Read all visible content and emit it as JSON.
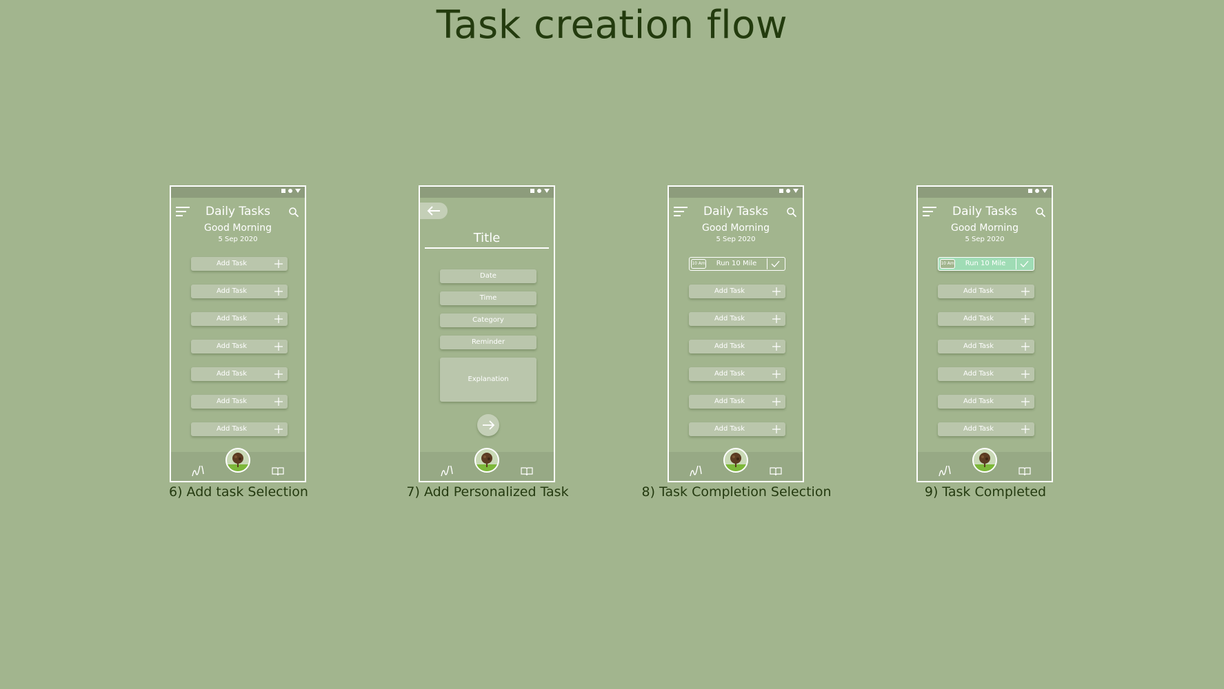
{
  "page_title": "Task creation flow",
  "colors": {
    "background": "#a2b58e",
    "title_text": "#233b0e",
    "button_fill": "#bac6ac",
    "completed_fill": "#9fdcb5",
    "phone_border": "#ffffff"
  },
  "screens": [
    {
      "caption": "6) Add task Selection",
      "app_title": "Daily Tasks",
      "greeting": "Good Morning",
      "date": "5 Sep 2020",
      "tasks": [
        "Add Task",
        "Add Task",
        "Add Task",
        "Add Task",
        "Add Task",
        "Add Task",
        "Add Task"
      ]
    },
    {
      "caption": "7) Add Personalized Task",
      "title": "Title",
      "fields": [
        "Date",
        "Time",
        "Category",
        "Reminder"
      ],
      "explanation": "Explanation"
    },
    {
      "caption": "8) Task Completion Selection",
      "app_title": "Daily Tasks",
      "greeting": "Good Morning",
      "date": "5 Sep 2020",
      "done_task": {
        "time": "10 Am",
        "label": "Run 10 Mile",
        "completed": false
      },
      "tasks": [
        "Add Task",
        "Add Task",
        "Add Task",
        "Add Task",
        "Add Task",
        "Add Task"
      ]
    },
    {
      "caption": "9) Task Completed",
      "app_title": "Daily Tasks",
      "greeting": "Good Morning",
      "date": "5 Sep 2020",
      "done_task": {
        "time": "10 Am",
        "label": "Run 10 Mile",
        "completed": true
      },
      "tasks": [
        "Add Task",
        "Add Task",
        "Add Task",
        "Add Task",
        "Add Task",
        "Add Task"
      ]
    }
  ]
}
